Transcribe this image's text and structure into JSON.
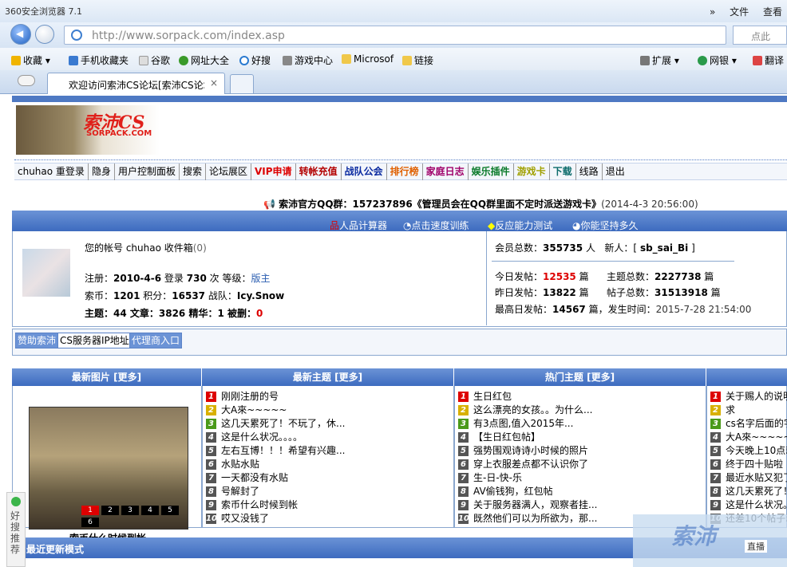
{
  "browser": {
    "title": "360安全浏览器 7.1",
    "menu_file": "文件",
    "menu_view": "查看",
    "menu_more": "»",
    "url": "http://www.sorpack.com/index.asp",
    "search_placeholder": "点此",
    "bookmarks": [
      "收藏",
      "手机收藏夹",
      "谷歌",
      "网址大全",
      "好搜",
      "游戏中心",
      "Microsof",
      "链接"
    ],
    "right_tools": [
      "扩展",
      "网银",
      "翻译"
    ],
    "tab_title": "欢迎访问索沛CS论坛[索沛CS论坛",
    "tab_close": "×"
  },
  "site": {
    "logo_text": "索沛CS",
    "logo_sub": "SORPACK.COM",
    "nav": [
      {
        "label": "chuhao 重登录",
        "color": "#000"
      },
      {
        "label": "隐身",
        "color": "#000"
      },
      {
        "label": "用户控制面板",
        "color": "#000"
      },
      {
        "label": "搜索",
        "color": "#000"
      },
      {
        "label": "论坛展区",
        "color": "#000"
      },
      {
        "label": "VIP申请",
        "color": "#d00"
      },
      {
        "label": "转帐充值",
        "color": "#b30000"
      },
      {
        "label": "战队公会",
        "color": "#0a2aa0"
      },
      {
        "label": "排行榜",
        "color": "#e06000"
      },
      {
        "label": "家庭日志",
        "color": "#a0006a"
      },
      {
        "label": "娱乐插件",
        "color": "#0a7a2a"
      },
      {
        "label": "游戏卡",
        "color": "#a0a000"
      },
      {
        "label": "下载",
        "color": "#0a6a6a"
      },
      {
        "label": "线路",
        "color": "#000"
      },
      {
        "label": "退出",
        "color": "#000"
      }
    ],
    "notice_text": "索沛官方QQ群：157237896《管理员会在QQ群里面不定时派送游戏卡》",
    "notice_time": "(2014-4-3 20:56:00)",
    "panel_links": [
      "人品计算器",
      "点击速度训练",
      "反应能力测试",
      "你能坚持多久"
    ],
    "user": {
      "account_line": "您的帐号  chuhao  收件箱",
      "inbox_count": "(0)",
      "reg_label": "注册：",
      "reg_date": "2010-4-6",
      "login_label": "登录",
      "login_count": "730",
      "login_unit": "次  等级：",
      "level": "版主",
      "coins_label": "索币：",
      "coins": "1201",
      "points_label": "积分：",
      "points": "16537",
      "team_label": "战队：",
      "team": "Icy.Snow",
      "topics_line": "主题：44  文章：3826  精华：1  被删：",
      "deleted": "0"
    },
    "stats": {
      "members_label": "会员总数：",
      "members": "355735",
      "members_unit": "人",
      "newbie_label": "新人：[",
      "newbie": "sb_sai_Bi",
      "newbie_end": "]",
      "today_label": "今日发帖：",
      "today": "12535",
      "today_unit": "篇",
      "topic_total_label": "主题总数：",
      "topic_total": "2227738",
      "topic_unit": "篇",
      "yesterday_label": "昨日发帖：",
      "yesterday": "13822",
      "yesterday_unit": "篇",
      "post_total_label": "帖子总数：",
      "post_total": "31513918",
      "post_unit": "篇",
      "max_label": "最高日发帖：",
      "max": "14567",
      "max_unit": "篇，发生时间：",
      "max_time": "2015-7-28 21:54:00"
    },
    "tabs": [
      "赞助索沛",
      "CS服务器IP地址",
      "代理商入口"
    ],
    "col_headers": [
      "最新图片 [更多]",
      "最新主题 [更多]",
      "热门主题 [更多]"
    ],
    "pic_caption": "索币什么时候到帐",
    "pic_pager": [
      "1",
      "2",
      "3",
      "4",
      "5",
      "6"
    ],
    "num_colors": [
      "#d00",
      "#d8b000",
      "#4a9a1a",
      "#555",
      "#555",
      "#555",
      "#555",
      "#555",
      "#555",
      "#555"
    ],
    "latest": [
      "刚刚注册的号",
      "大A來~~~~~",
      "这几天累死了！不玩了，休...",
      "这是什么状况。。。。",
      "左右互博！！！希望有兴趣...",
      "水贴水贴",
      "一天都没有水贴",
      "号解封了",
      "索币什么时候到帐",
      "哎又没钱了"
    ],
    "hot": [
      "生日红包",
      "这么漂亮的女孩。。为什么...",
      "有3点图,值入2015年...",
      "【生日红包帖】",
      "强势围观诗诗小时候的照片",
      "穿上衣服差点都不认识你了",
      "生-日-快-乐",
      "AV偷钱狗，红包帖",
      "关于服务器满人，观察者挂...",
      "既然他们可以为所欲为，那..."
    ],
    "more": [
      "关于赐人的说明",
      "求",
      "cs名字后面的字",
      "大A來~~~~~",
      "今天晚上10点就",
      "终于四十贴啦",
      "最近水贴又犯了",
      "这几天累死了！",
      "这是什么状况。",
      "还差10个帖子就"
    ],
    "bottom_title": "最近更新模式",
    "side_text": "好搜推荐",
    "watermark_text": "索沛",
    "watermark_live": "直播"
  }
}
